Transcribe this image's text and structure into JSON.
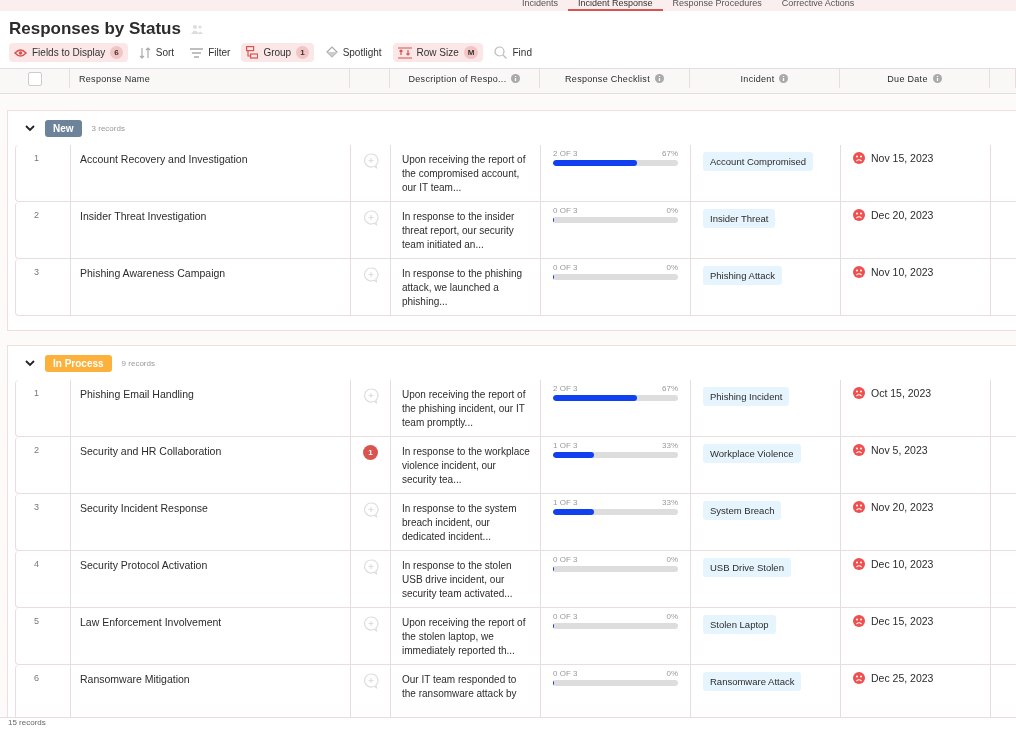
{
  "tabs": [
    {
      "label": "Incidents",
      "selected": false
    },
    {
      "label": "Incident Response",
      "selected": true
    },
    {
      "label": "Response Procedures",
      "selected": false
    },
    {
      "label": "Corrective Actions",
      "selected": false
    }
  ],
  "title": "Responses by Status",
  "toolbar": [
    {
      "kind": "fields",
      "label": "Fields to Display",
      "badge": "6",
      "active": true
    },
    {
      "kind": "sort",
      "label": "Sort",
      "active": false
    },
    {
      "kind": "filter",
      "label": "Filter",
      "active": false
    },
    {
      "kind": "group",
      "label": "Group",
      "badge": "1",
      "active": true
    },
    {
      "kind": "spotlight",
      "label": "Spotlight",
      "active": false
    },
    {
      "kind": "rowsize",
      "label": "Row Size",
      "badge": "M",
      "active": true
    },
    {
      "kind": "find",
      "label": "Find",
      "active": false
    }
  ],
  "select_all": {
    "checked": false
  },
  "columns": [
    {
      "label": "Response Name",
      "info": false
    },
    {
      "label": "Description of Respo...",
      "info": true
    },
    {
      "label": "Response Checklist",
      "info": true
    },
    {
      "label": "Incident",
      "info": true
    },
    {
      "label": "Due Date",
      "info": true
    }
  ],
  "groups": [
    {
      "label": "New",
      "color": "#6d8399",
      "count": "3 records",
      "expanded": true,
      "rows": [
        {
          "number": "1",
          "name": "Account Recovery and Investigation",
          "description": "Upon receiving the report of the compromised account, our IT team...",
          "progress": "2 OF 3",
          "percent": "67%",
          "level": 0.67,
          "incident": "Account Compromised",
          "due": "Nov 15, 2023",
          "overdue": true
        },
        {
          "number": "2",
          "name": "Insider Threat Investigation",
          "description": "In response to the insider threat report, our security team initiated an...",
          "progress": "0 OF 3",
          "percent": "0%",
          "level": 0,
          "incident": "Insider Threat",
          "due": "Dec 20, 2023",
          "overdue": true
        },
        {
          "number": "3",
          "name": "Phishing Awareness Campaign",
          "description": "In response to the phishing attack, we launched a phishing...",
          "progress": "0 OF 3",
          "percent": "0%",
          "level": 0,
          "incident": "Phishing Attack",
          "due": "Nov 10, 2023",
          "overdue": true
        }
      ]
    },
    {
      "label": "In Process",
      "color": "#fbb13c",
      "count": "9 records",
      "expanded": true,
      "rows": [
        {
          "number": "1",
          "name": "Phishing Email Handling",
          "description": "Upon receiving the report of the phishing incident, our IT team promptly...",
          "progress": "2 OF 3",
          "percent": "67%",
          "level": 0.67,
          "incident": "Phishing Incident",
          "due": "Oct 15, 2023",
          "overdue": true
        },
        {
          "number": "2",
          "name": "Security and HR Collaboration",
          "comments": "1",
          "description": "In response to the workplace violence incident, our security tea...",
          "progress": "1 OF 3",
          "percent": "33%",
          "level": 0.33,
          "incident": "Workplace Violence",
          "due": "Nov 5, 2023",
          "overdue": true
        },
        {
          "number": "3",
          "name": "Security Incident Response",
          "description": "In response to the system breach incident, our dedicated incident...",
          "progress": "1 OF 3",
          "percent": "33%",
          "level": 0.33,
          "incident": "System Breach",
          "due": "Nov 20, 2023",
          "overdue": true
        },
        {
          "number": "4",
          "name": "Security Protocol Activation",
          "description": "In response to the stolen USB drive incident, our security team activated...",
          "progress": "0 OF 3",
          "percent": "0%",
          "level": 0,
          "incident": "USB Drive Stolen",
          "due": "Dec 10, 2023",
          "overdue": true
        },
        {
          "number": "5",
          "name": "Law Enforcement Involvement",
          "description": "Upon receiving the report of the stolen laptop, we immediately reported th...",
          "progress": "0 OF 3",
          "percent": "0%",
          "level": 0,
          "incident": "Stolen Laptop",
          "due": "Dec 15, 2023",
          "overdue": true
        },
        {
          "number": "6",
          "name": "Ransomware Mitigation",
          "description": "Our IT team responded to the ransomware attack by",
          "progress": "0 OF 3",
          "percent": "0%",
          "level": 0,
          "incident": "Ransomware Attack",
          "due": "Dec 25, 2023",
          "overdue": true
        }
      ]
    }
  ],
  "footer": "15 records"
}
